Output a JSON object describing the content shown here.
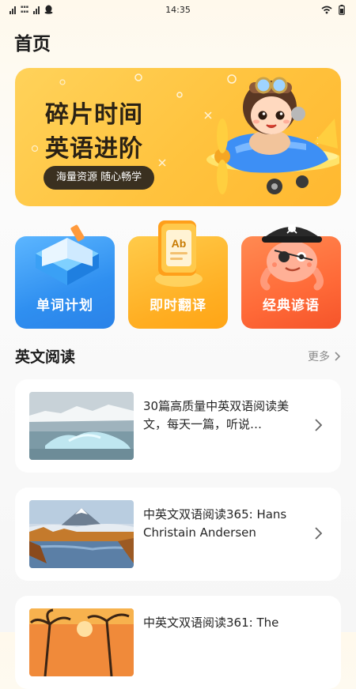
{
  "status_bar": {
    "time": "14:35"
  },
  "page": {
    "title": "首页"
  },
  "banner": {
    "line1": "碎片时间",
    "line2": "英语进阶",
    "pill": "海量资源 随心畅学"
  },
  "features": [
    {
      "label": "单词计划",
      "icon": "book-icon",
      "color": "#2f94f2"
    },
    {
      "label": "即时翻译",
      "icon": "translate-card-icon",
      "color": "#ffb12a"
    },
    {
      "label": "经典谚语",
      "icon": "pirate-octopus-icon",
      "color": "#ff6a3a"
    }
  ],
  "reading": {
    "title": "英文阅读",
    "more": "更多",
    "items": [
      {
        "title": "30篇高质量中英双语阅读美文，每天一篇，听说…",
        "thumb": "glacier-lake-image"
      },
      {
        "title": "中英文双语阅读365: Hans Christain Andersen",
        "thumb": "mountain-lake-image"
      },
      {
        "title": "中英文双语阅读361: The",
        "thumb": "palm-sunset-image"
      }
    ]
  }
}
